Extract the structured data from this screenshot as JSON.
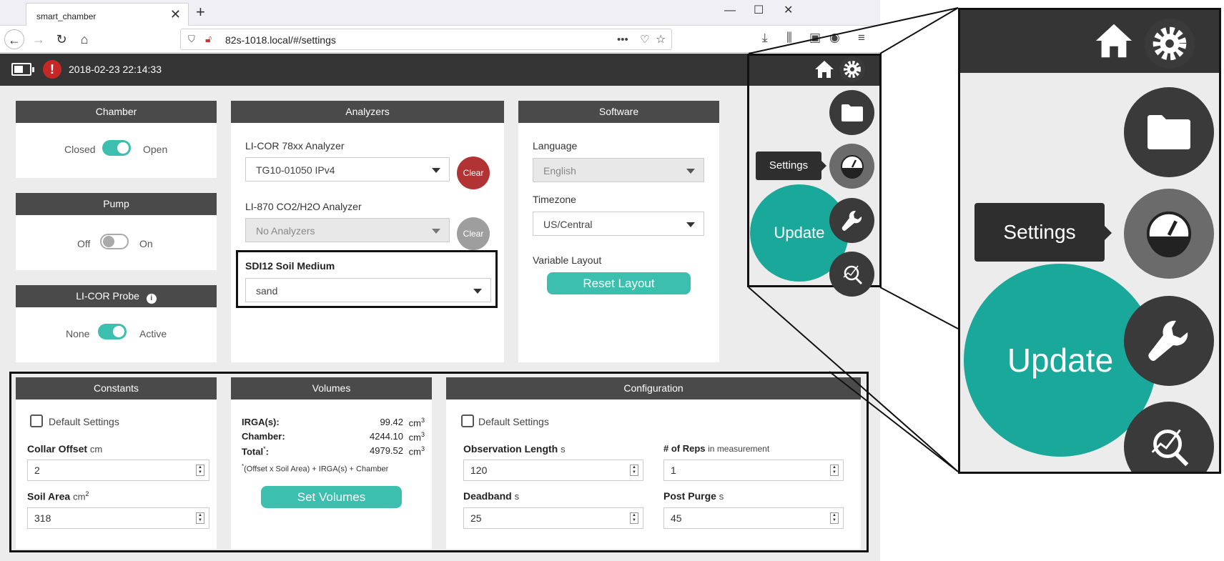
{
  "browser": {
    "tab_title": "smart_chamber",
    "tab_close": "✕",
    "new_tab": "+",
    "url": "82s-1018.local/#/settings",
    "minimize": "—",
    "maximize": "☐",
    "close": "✕"
  },
  "header": {
    "datetime": "2018-02-23 22:14:33",
    "alert_glyph": "!"
  },
  "chamber": {
    "title": "Chamber",
    "left_label": "Closed",
    "right_label": "Open",
    "state": "open"
  },
  "pump": {
    "title": "Pump",
    "left_label": "Off",
    "right_label": "On",
    "state": "off"
  },
  "probe": {
    "title": "LI-COR Probe",
    "left_label": "None",
    "right_label": "Active",
    "state": "active"
  },
  "analyzers": {
    "title": "Analyzers",
    "licor78_label": "LI-COR 78xx Analyzer",
    "licor78_value": "TG10-01050 IPv4",
    "clear_label": "Clear",
    "li870_label": "LI-870 CO2/H2O Analyzer",
    "li870_value": "No Analyzers",
    "sdi_label": "SDI12 Soil Medium",
    "sdi_value": "sand",
    "clear_active_color": "#b23333",
    "clear_disabled_color": "#9e9e9e"
  },
  "software": {
    "title": "Software",
    "language_label": "Language",
    "language_value": "English",
    "timezone_label": "Timezone",
    "timezone_value": "US/Central",
    "layout_label": "Variable Layout",
    "reset_label": "Reset Layout"
  },
  "constants": {
    "title": "Constants",
    "default_label": "Default Settings",
    "collar_label": "Collar Offset",
    "collar_unit": "cm",
    "collar_value": "2",
    "soil_label": "Soil Area",
    "soil_unit": "cm",
    "soil_sup": "2",
    "soil_value": "318"
  },
  "volumes": {
    "title": "Volumes",
    "irga_label": "IRGA(s):",
    "irga_value": "99.42",
    "chamber_label": "Chamber:",
    "chamber_value": "4244.10",
    "total_label": "Total",
    "total_mark": "*",
    "total_value": "4979.52",
    "unit": "cm",
    "unit_sup": "3",
    "footnote_mark": "*",
    "footnote": "(Offset x Soil Area) + IRGA(s) + Chamber",
    "button": "Set Volumes"
  },
  "configuration": {
    "title": "Configuration",
    "default_label": "Default Settings",
    "obs_label": "Observation Length",
    "obs_unit": "s",
    "obs_value": "120",
    "reps_label": "# of Reps",
    "reps_unit": "in measurement",
    "reps_value": "1",
    "deadband_label": "Deadband",
    "deadband_unit": "s",
    "deadband_value": "25",
    "purge_label": "Post Purge",
    "purge_unit": "s",
    "purge_value": "45"
  },
  "menu": {
    "tooltip": "Settings",
    "update": "Update",
    "icons": [
      "home-icon",
      "gear-icon",
      "folder-icon",
      "gauge-icon",
      "wrench-icon",
      "search-chart-icon"
    ]
  },
  "colors": {
    "teal": "#1aa89a",
    "header": "#353535",
    "card_header": "#4a4a4a"
  }
}
